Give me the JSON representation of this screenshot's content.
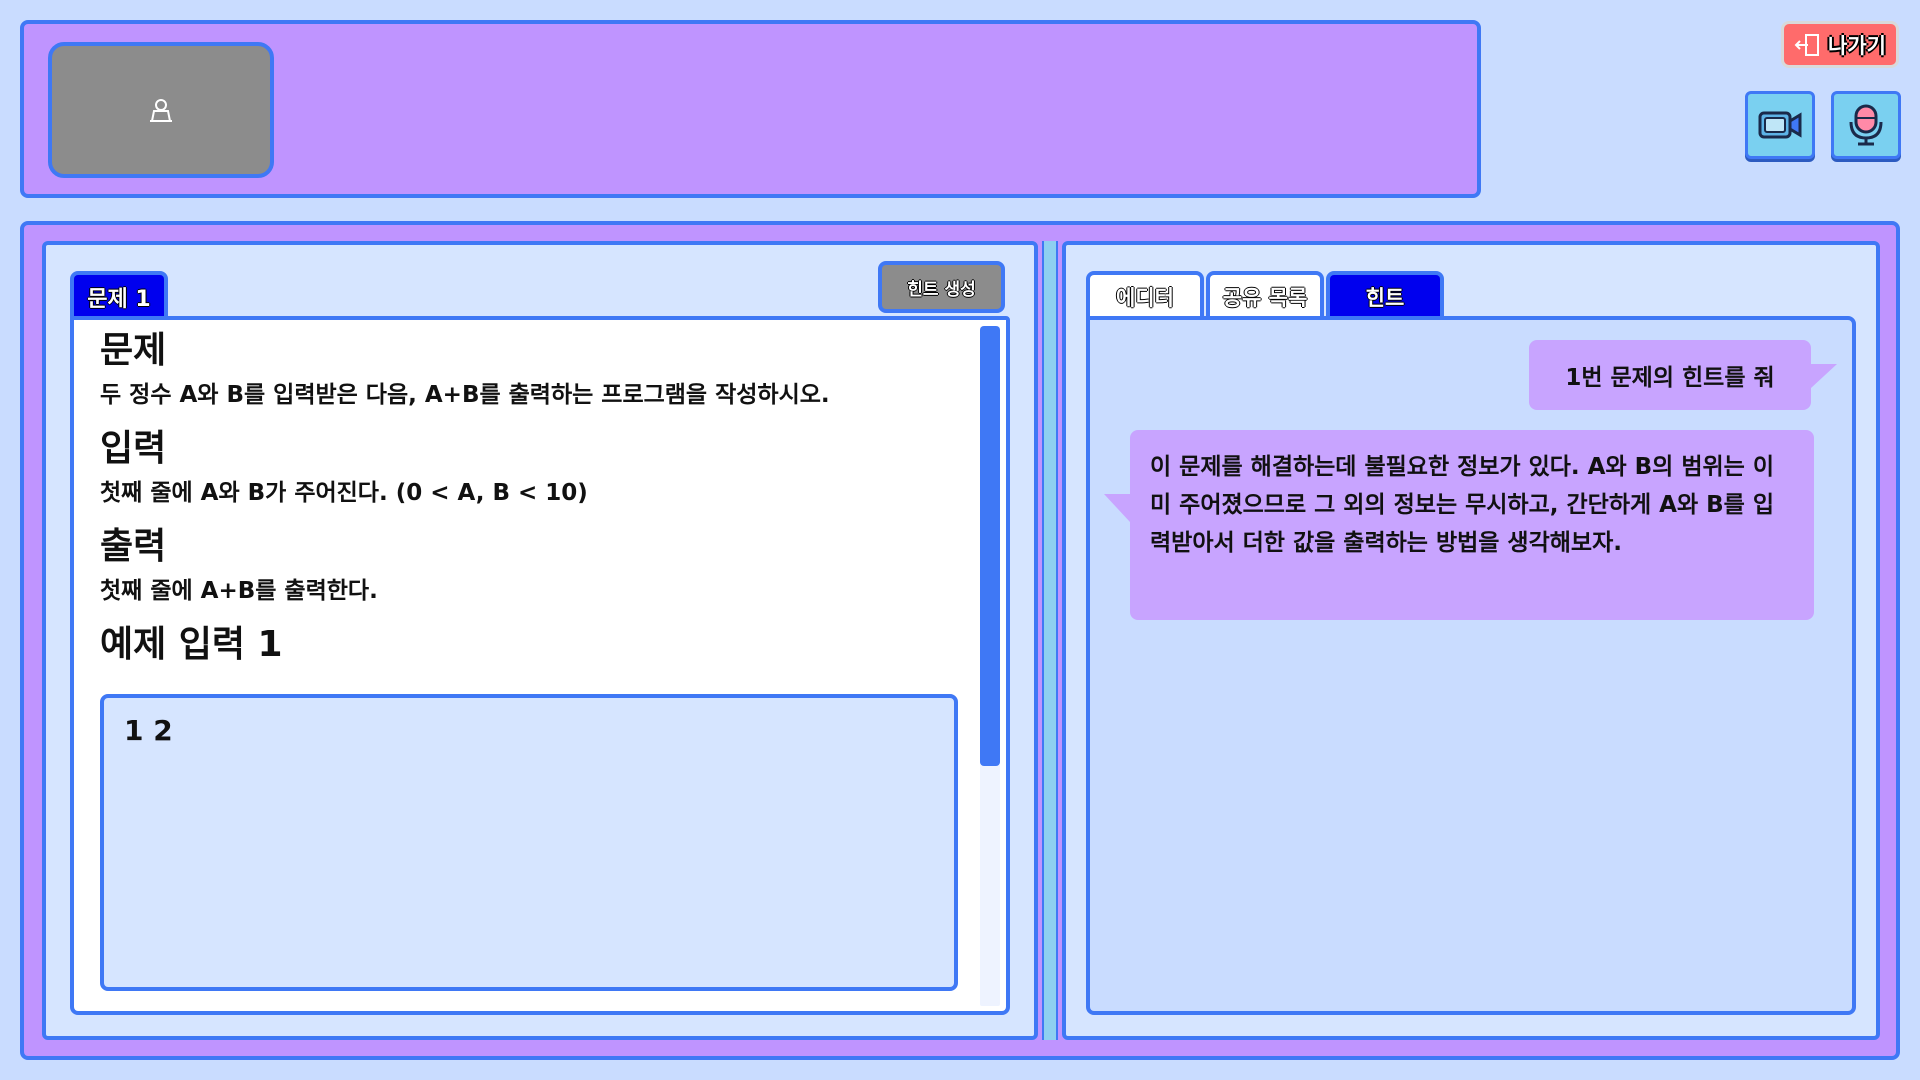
{
  "header": {
    "exit_label": "나가기"
  },
  "icons": {
    "video_placeholder": "person-placeholder-icon",
    "exit": "exit-door-icon",
    "camera": "video-camera-icon",
    "mic": "microphone-icon"
  },
  "colors": {
    "background": "#c9dcff",
    "panel": "#bf94ff",
    "border": "#3f78f5",
    "tab_active": "#0000ee",
    "exit_button": "#ff6b6b",
    "hint_button": "#8c8c8c",
    "bubble": "#c8a4ff"
  },
  "problem_panel": {
    "tab_label": "문제 1",
    "hint_button_label": "힌트 생성",
    "problem_heading": "문제",
    "problem_text": "두 정수 A와 B를 입력받은 다음, A+B를 출력하는 프로그램을 작성하시오.",
    "input_heading": "입력",
    "input_text": "첫째 줄에 A와 B가 주어진다. (0 < A, B < 10)",
    "output_heading": "출력",
    "output_text": "첫째 줄에 A+B를 출력한다.",
    "example_heading": "예제 입력 1",
    "example_value": "1 2"
  },
  "right_panel": {
    "tabs": [
      {
        "label": "에디터",
        "active": false
      },
      {
        "label": "공유 목록",
        "active": false
      },
      {
        "label": "힌트",
        "active": true
      }
    ],
    "chat": {
      "user_message": "1번 문제의 힌트를 줘",
      "bot_message": "이 문제를 해결하는데 불필요한 정보가 있다. A와 B의 범위는 이미 주어졌으므로 그 외의 정보는 무시하고, 간단하게 A와 B를 입력받아서 더한 값을 출력하는 방법을 생각해보자."
    }
  }
}
